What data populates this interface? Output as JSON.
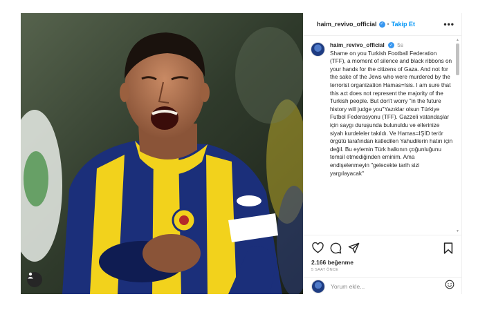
{
  "post": {
    "username": "haim_revivo_official",
    "follow_label": "Takip Et",
    "more_label": "•••",
    "caption_time": "5s",
    "caption_text": "Shame on you Turkish Football Federation (TFF), a moment of silence and black ribbons on your hands for the citizens of Gaza. And not for the sake of the Jews who were murdered by the terrorist organization Hamas=Isis. I am sure that this act does not represent the majority of the Turkish people. But don't worry \"in the future history will judge you\"Yazıklar olsun Türkiye Futbol Federasyonu (TFF). Gazzeli vatandaşlar için saygı duruşunda bulunuldu ve ellerinize siyah kurdeleler takıldı. Ve Hamas=IŞİD terör örgütü tarafından katledilen Yahudilerin hatırı için değil. Bu eylemin Türk halkının çoğunluğunu temsil etmediğinden eminim. Ama endişelenmeyin \"gelecekte tarih sizi yargılayacak\"",
    "likes": "2.166 beğenme",
    "time_ago": "5 SAAT ÖNCE",
    "comment_placeholder": "Yorum ekle..."
  },
  "icons": {
    "like": "heart-icon",
    "comment": "comment-icon",
    "share": "share-icon",
    "save": "bookmark-icon",
    "emoji": "emoji-icon",
    "tag": "user-tag-icon",
    "verified": "verified-badge"
  },
  "colors": {
    "accent": "#0095f6",
    "verified": "#3897f0",
    "jersey_yellow": "#f2d21c",
    "jersey_blue": "#1b2f7a"
  }
}
